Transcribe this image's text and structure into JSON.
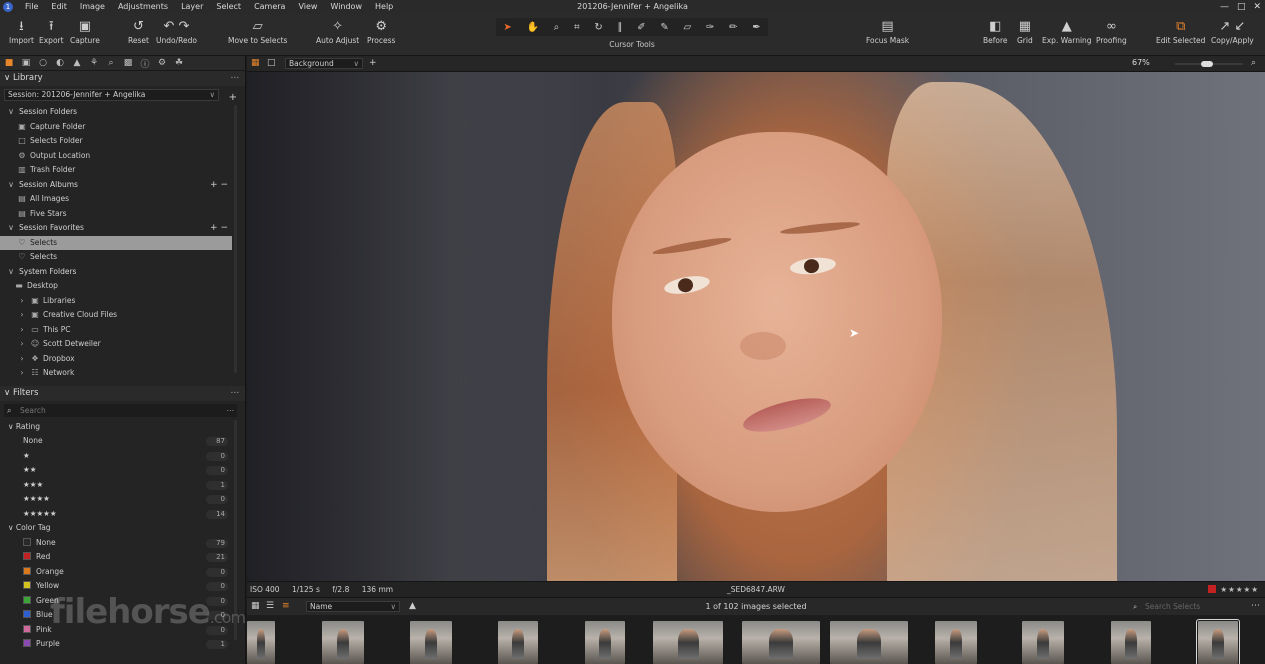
{
  "window": {
    "title": "201206-Jennifer + Angelika",
    "controls": [
      "—",
      "□",
      "✕"
    ]
  },
  "menu": [
    "File",
    "Edit",
    "Image",
    "Adjustments",
    "Layer",
    "Select",
    "Camera",
    "View",
    "Window",
    "Help"
  ],
  "toolbar": {
    "import": "Import",
    "export": "Export",
    "capture": "Capture",
    "reset": "Reset",
    "undo_redo": "Undo/Redo",
    "move_to_selects": "Move to Selects",
    "auto_adjust": "Auto Adjust",
    "process": "Process",
    "cursor_tools": "Cursor Tools",
    "focus_mask": "Focus Mask",
    "before": "Before",
    "grid": "Grid",
    "exp_warning": "Exp. Warning",
    "proofing": "Proofing",
    "edit_selected": "Edit Selected",
    "copy_apply": "Copy/Apply"
  },
  "library": {
    "title": "Library",
    "session": "Session: 201206-Jennifer + Angelika",
    "session_folders": {
      "label": "Session Folders",
      "items": [
        "Capture Folder",
        "Selects Folder",
        "Output Location",
        "Trash Folder"
      ]
    },
    "session_albums": {
      "label": "Session Albums",
      "items": [
        "All Images",
        "Five Stars"
      ]
    },
    "session_favorites": {
      "label": "Session Favorites",
      "items": [
        "Selects",
        "Selects"
      ]
    },
    "system_folders": {
      "label": "System Folders",
      "desktop": "Desktop",
      "items": [
        "Libraries",
        "Creative Cloud Files",
        "This PC",
        "Scott Detweiler",
        "Dropbox",
        "Network"
      ]
    }
  },
  "filters": {
    "title": "Filters",
    "search_placeholder": "Search",
    "rating_label": "Rating",
    "ratings": [
      {
        "label": "None",
        "count": "87"
      },
      {
        "label": "★",
        "count": "0"
      },
      {
        "label": "★★",
        "count": "0"
      },
      {
        "label": "★★★",
        "count": "1"
      },
      {
        "label": "★★★★",
        "count": "0"
      },
      {
        "label": "★★★★★",
        "count": "14"
      }
    ],
    "color_tag_label": "Color Tag",
    "color_tags": [
      {
        "label": "None",
        "count": "79",
        "color": "#2a2a2a"
      },
      {
        "label": "Red",
        "count": "21",
        "color": "#c42222"
      },
      {
        "label": "Orange",
        "count": "0",
        "color": "#d9791e"
      },
      {
        "label": "Yellow",
        "count": "0",
        "color": "#d4c21e"
      },
      {
        "label": "Green",
        "count": "0",
        "color": "#3aa63a"
      },
      {
        "label": "Blue",
        "count": "0",
        "color": "#2d5fd0"
      },
      {
        "label": "Pink",
        "count": "0",
        "color": "#d06a9a"
      },
      {
        "label": "Purple",
        "count": "1",
        "color": "#8a4ab0"
      }
    ]
  },
  "viewer": {
    "background": "Background",
    "zoom": "67%",
    "exif": {
      "iso": "ISO 400",
      "shutter": "1/125 s",
      "aperture": "f/2.8",
      "focal": "136 mm"
    },
    "filename": "_SED6847.ARW",
    "stars": "★★★★★"
  },
  "browser": {
    "sort": "Name",
    "selected_count": "1 of 102 images selected",
    "search_placeholder": "Search Selects"
  },
  "watermark": {
    "main": "filehorse",
    "suffix": ".com"
  }
}
